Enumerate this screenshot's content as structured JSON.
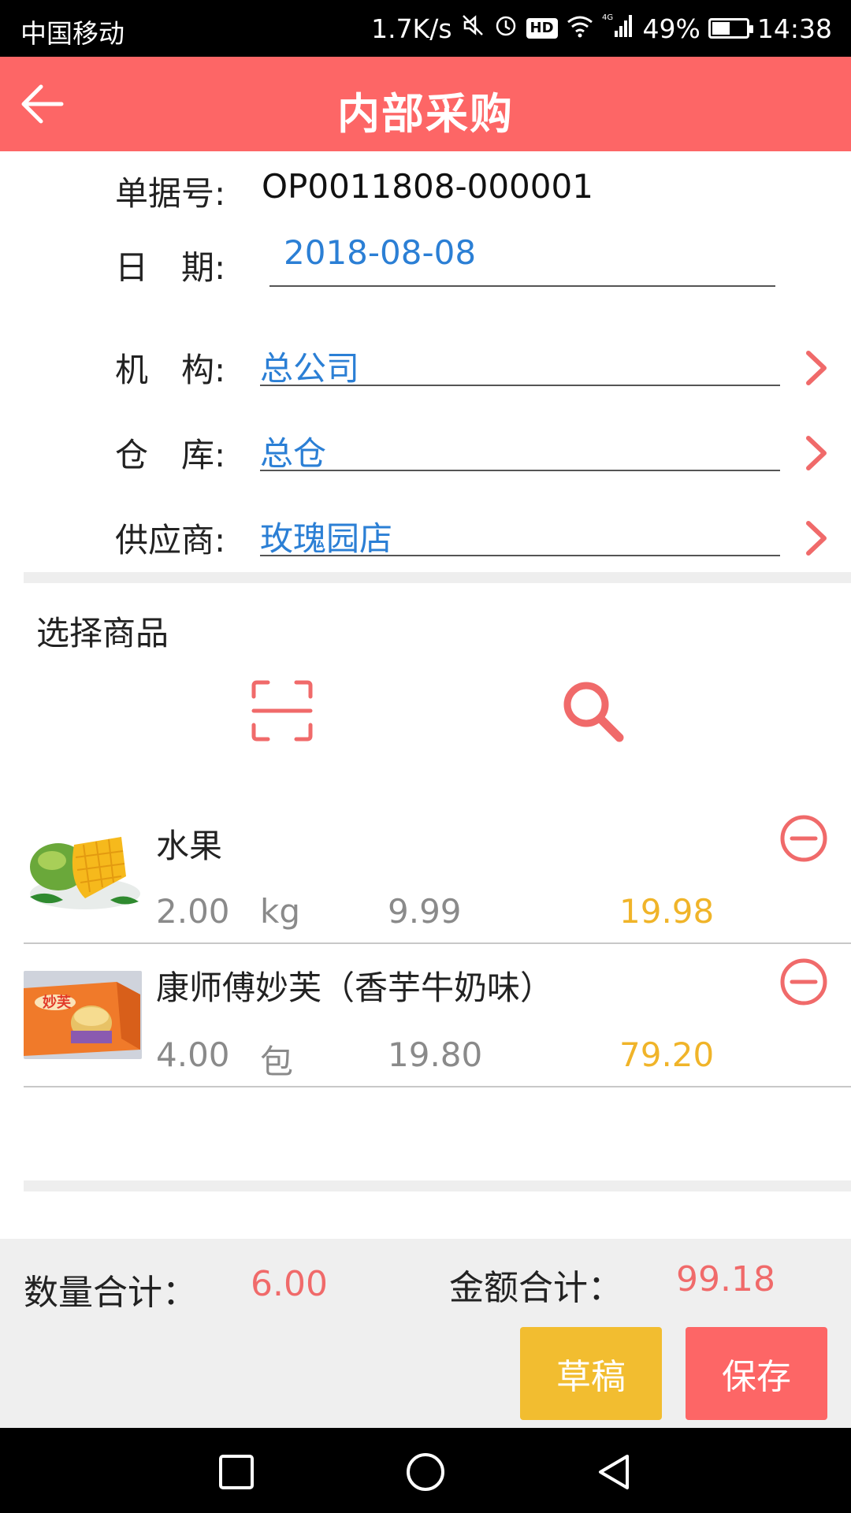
{
  "status": {
    "carrier": "中国移动",
    "speed": "1.7K/s",
    "hd": "HD",
    "network": "4G",
    "battery": "49%",
    "battery_level": 0.49,
    "time": "14:38"
  },
  "header": {
    "title": "内部采购",
    "back_icon": "arrow-left-icon"
  },
  "form": {
    "doc_no_label": "单据号:",
    "doc_no": "OP0011808-000001",
    "date_label": "日　期:",
    "date": "2018-08-08",
    "org_label": "机　构:",
    "org": "总公司",
    "warehouse_label": "仓　库:",
    "warehouse": "总仓",
    "supplier_label": "供应商:",
    "supplier": "玫瑰园店"
  },
  "goods": {
    "section_title": "选择商品",
    "scan_icon": "scan-icon",
    "search_icon": "search-icon",
    "items": [
      {
        "name": "水果",
        "qty": "2.00",
        "unit": "kg",
        "price": "9.99",
        "amount": "19.98",
        "thumb": "mango-image"
      },
      {
        "name": "康师傅妙芙（香芋牛奶味）",
        "qty": "4.00",
        "unit": "包",
        "price": "19.80",
        "amount": "79.20",
        "thumb": "cake-box-image"
      }
    ]
  },
  "footer": {
    "qty_total_label": "数量合计：",
    "qty_total": "6.00",
    "amount_total_label": "金额合计：",
    "amount_total": "99.18",
    "draft_label": "草稿",
    "save_label": "保存"
  },
  "colors": {
    "brand": "#fd6666",
    "link": "#2b7fd5",
    "amount": "#f0b429",
    "draft": "#f2bd30"
  }
}
